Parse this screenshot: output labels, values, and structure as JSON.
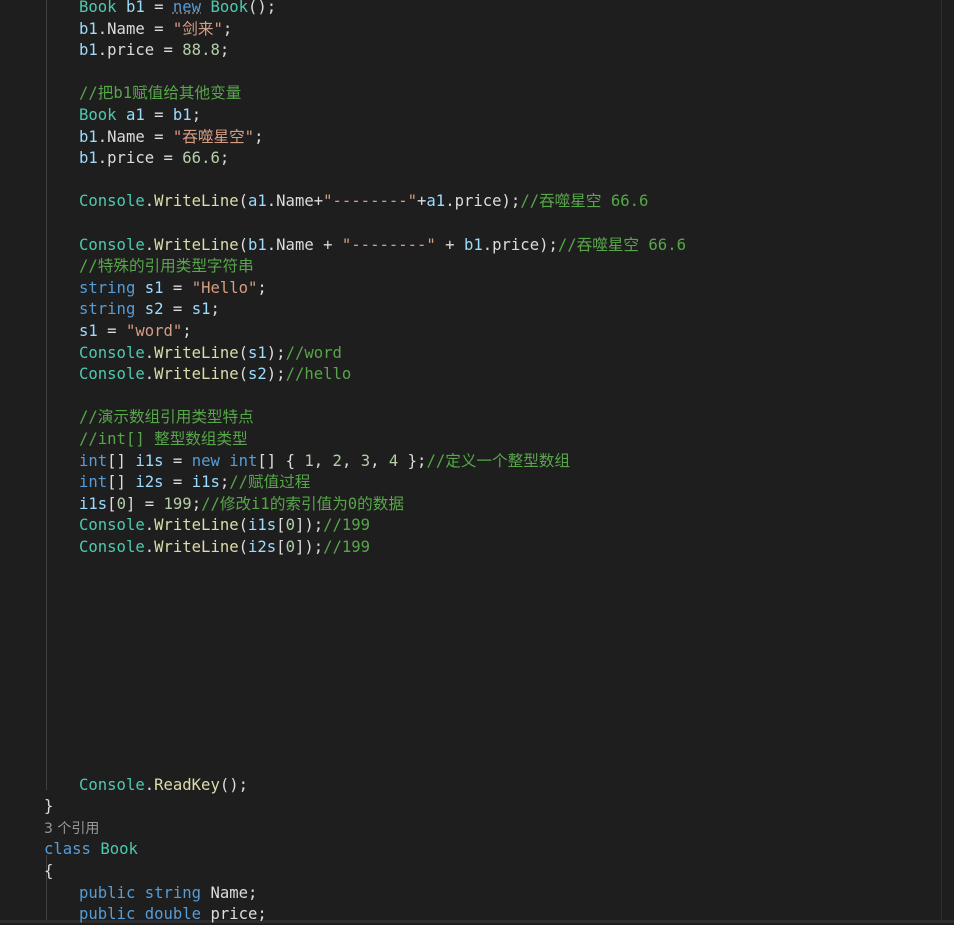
{
  "theme": {
    "background": "#1e1e1e",
    "keyword": "#569cd6",
    "type": "#4ec9b0",
    "variable": "#9cdcfe",
    "property": "#dcdcdc",
    "method": "#dcdcaa",
    "string": "#d69d85",
    "number": "#b5cea8",
    "comment": "#57a64a",
    "punctuation": "#dcdcdc",
    "codelens": "#999999"
  },
  "code_lines": [
    [
      [
        "type",
        "Book"
      ],
      [
        "punc",
        " "
      ],
      [
        "var",
        "b1"
      ],
      [
        "punc",
        " = "
      ],
      [
        "kw",
        "new"
      ],
      [
        "punc",
        " "
      ],
      [
        "type",
        "Book"
      ],
      [
        "punc",
        "();"
      ]
    ],
    [
      [
        "var",
        "b1"
      ],
      [
        "punc",
        "."
      ],
      [
        "prop",
        "Name"
      ],
      [
        "punc",
        " = "
      ],
      [
        "str",
        "\"剑来\""
      ],
      [
        "punc",
        ";"
      ]
    ],
    [
      [
        "var",
        "b1"
      ],
      [
        "punc",
        "."
      ],
      [
        "prop",
        "price"
      ],
      [
        "punc",
        " = "
      ],
      [
        "num",
        "88.8"
      ],
      [
        "punc",
        ";"
      ]
    ],
    [],
    [
      [
        "com",
        "//把b1赋值给其他变量"
      ]
    ],
    [
      [
        "type",
        "Book"
      ],
      [
        "punc",
        " "
      ],
      [
        "var",
        "a1"
      ],
      [
        "punc",
        " = "
      ],
      [
        "var",
        "b1"
      ],
      [
        "punc",
        ";"
      ]
    ],
    [
      [
        "var",
        "b1"
      ],
      [
        "punc",
        "."
      ],
      [
        "prop",
        "Name"
      ],
      [
        "punc",
        " = "
      ],
      [
        "str",
        "\"吞噬星空\""
      ],
      [
        "punc",
        ";"
      ]
    ],
    [
      [
        "var",
        "b1"
      ],
      [
        "punc",
        "."
      ],
      [
        "prop",
        "price"
      ],
      [
        "punc",
        " = "
      ],
      [
        "num",
        "66.6"
      ],
      [
        "punc",
        ";"
      ]
    ],
    [],
    [
      [
        "type",
        "Console"
      ],
      [
        "punc",
        "."
      ],
      [
        "method",
        "WriteLine"
      ],
      [
        "punc",
        "("
      ],
      [
        "var",
        "a1"
      ],
      [
        "punc",
        "."
      ],
      [
        "prop",
        "Name"
      ],
      [
        "punc",
        "+"
      ],
      [
        "str",
        "\"--------\""
      ],
      [
        "punc",
        "+"
      ],
      [
        "var",
        "a1"
      ],
      [
        "punc",
        "."
      ],
      [
        "prop",
        "price"
      ],
      [
        "punc",
        ");"
      ],
      [
        "com",
        "//吞噬星空 66.6"
      ]
    ],
    [],
    [
      [
        "type",
        "Console"
      ],
      [
        "punc",
        "."
      ],
      [
        "method",
        "WriteLine"
      ],
      [
        "punc",
        "("
      ],
      [
        "var",
        "b1"
      ],
      [
        "punc",
        "."
      ],
      [
        "prop",
        "Name"
      ],
      [
        "punc",
        " + "
      ],
      [
        "str",
        "\"--------\""
      ],
      [
        "punc",
        " + "
      ],
      [
        "var",
        "b1"
      ],
      [
        "punc",
        "."
      ],
      [
        "prop",
        "price"
      ],
      [
        "punc",
        ");"
      ],
      [
        "com",
        "//吞噬星空 66.6"
      ]
    ],
    [
      [
        "com",
        "//特殊的引用类型字符串"
      ]
    ],
    [
      [
        "kw",
        "string"
      ],
      [
        "punc",
        " "
      ],
      [
        "var",
        "s1"
      ],
      [
        "punc",
        " = "
      ],
      [
        "str",
        "\"Hello\""
      ],
      [
        "punc",
        ";"
      ]
    ],
    [
      [
        "kw",
        "string"
      ],
      [
        "punc",
        " "
      ],
      [
        "var",
        "s2"
      ],
      [
        "punc",
        " = "
      ],
      [
        "var",
        "s1"
      ],
      [
        "punc",
        ";"
      ]
    ],
    [
      [
        "var",
        "s1"
      ],
      [
        "punc",
        " = "
      ],
      [
        "str",
        "\"word\""
      ],
      [
        "punc",
        ";"
      ]
    ],
    [
      [
        "type",
        "Console"
      ],
      [
        "punc",
        "."
      ],
      [
        "method",
        "WriteLine"
      ],
      [
        "punc",
        "("
      ],
      [
        "var",
        "s1"
      ],
      [
        "punc",
        ");"
      ],
      [
        "com",
        "//word"
      ]
    ],
    [
      [
        "type",
        "Console"
      ],
      [
        "punc",
        "."
      ],
      [
        "method",
        "WriteLine"
      ],
      [
        "punc",
        "("
      ],
      [
        "var",
        "s2"
      ],
      [
        "punc",
        ");"
      ],
      [
        "com",
        "//hello"
      ]
    ],
    [],
    [
      [
        "com",
        "//演示数组引用类型特点"
      ]
    ],
    [
      [
        "com",
        "//int[] 整型数组类型"
      ]
    ],
    [
      [
        "kw",
        "int"
      ],
      [
        "punc",
        "[] "
      ],
      [
        "var",
        "i1s"
      ],
      [
        "punc",
        " = "
      ],
      [
        "kw",
        "new"
      ],
      [
        "punc",
        " "
      ],
      [
        "kw",
        "int"
      ],
      [
        "punc",
        "[] { "
      ],
      [
        "num",
        "1"
      ],
      [
        "punc",
        ", "
      ],
      [
        "num",
        "2"
      ],
      [
        "punc",
        ", "
      ],
      [
        "num",
        "3"
      ],
      [
        "punc",
        ", "
      ],
      [
        "num",
        "4"
      ],
      [
        "punc",
        " };"
      ],
      [
        "com",
        "//定义一个整型数组"
      ]
    ],
    [
      [
        "kw",
        "int"
      ],
      [
        "punc",
        "[] "
      ],
      [
        "var",
        "i2s"
      ],
      [
        "punc",
        " = "
      ],
      [
        "var",
        "i1s"
      ],
      [
        "punc",
        ";"
      ],
      [
        "com",
        "//赋值过程"
      ]
    ],
    [
      [
        "var",
        "i1s"
      ],
      [
        "punc",
        "["
      ],
      [
        "num",
        "0"
      ],
      [
        "punc",
        "] = "
      ],
      [
        "num",
        "199"
      ],
      [
        "punc",
        ";"
      ],
      [
        "com",
        "//修改i1的索引值为0的数据"
      ]
    ],
    [
      [
        "type",
        "Console"
      ],
      [
        "punc",
        "."
      ],
      [
        "method",
        "WriteLine"
      ],
      [
        "punc",
        "("
      ],
      [
        "var",
        "i1s"
      ],
      [
        "punc",
        "["
      ],
      [
        "num",
        "0"
      ],
      [
        "punc",
        "]);"
      ],
      [
        "com",
        "//199"
      ]
    ],
    [
      [
        "type",
        "Console"
      ],
      [
        "punc",
        "."
      ],
      [
        "method",
        "WriteLine"
      ],
      [
        "punc",
        "("
      ],
      [
        "var",
        "i2s"
      ],
      [
        "punc",
        "["
      ],
      [
        "num",
        "0"
      ],
      [
        "punc",
        "]);"
      ],
      [
        "com",
        "//199"
      ]
    ],
    [],
    [],
    [],
    [],
    [],
    [],
    [],
    [],
    [],
    [],
    [
      [
        "type",
        "Console"
      ],
      [
        "punc",
        "."
      ],
      [
        "method",
        "ReadKey"
      ],
      [
        "punc",
        "();"
      ]
    ],
    [
      [
        "punc",
        "}"
      ]
    ],
    [
      [
        "lens",
        "3 个引用"
      ]
    ],
    [
      [
        "kw",
        "class"
      ],
      [
        "punc",
        " "
      ],
      [
        "type",
        "Book"
      ]
    ],
    [
      [
        "punc",
        "{"
      ]
    ],
    [
      [
        "kw",
        "public"
      ],
      [
        "punc",
        " "
      ],
      [
        "kw",
        "string"
      ],
      [
        "punc",
        " "
      ],
      [
        "prop",
        "Name"
      ],
      [
        "punc",
        ";"
      ]
    ],
    [
      [
        "kw",
        "public"
      ],
      [
        "punc",
        " "
      ],
      [
        "kw",
        "double"
      ],
      [
        "punc",
        " "
      ],
      [
        "prop",
        "price"
      ],
      [
        "punc",
        ";"
      ]
    ]
  ]
}
